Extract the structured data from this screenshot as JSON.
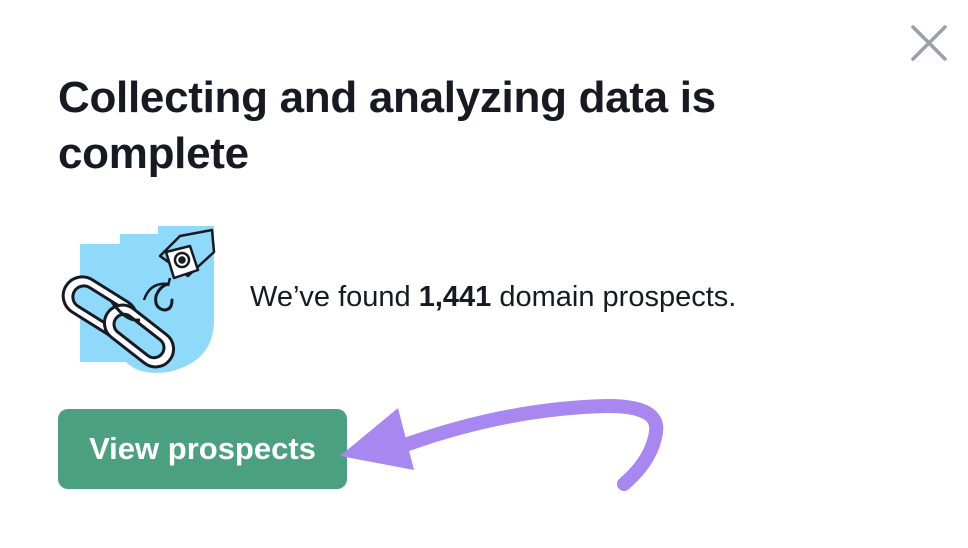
{
  "dialog": {
    "title": "Collecting and analyzing data is complete",
    "close_icon": "close-icon",
    "illustration_icon": "chain-link-hook-illustration",
    "summary": {
      "prefix": "We’ve found ",
      "count": "1,441",
      "suffix": " domain prospects."
    },
    "cta_label": "View prospects"
  },
  "annotation": {
    "arrow_icon": "pointer-arrow-annotation",
    "arrow_color": "#a987f0"
  },
  "colors": {
    "primary_button": "#4aa07f",
    "text": "#171a22",
    "illustration_bg": "#8fd9fb",
    "close_icon": "#9aa0a8"
  }
}
